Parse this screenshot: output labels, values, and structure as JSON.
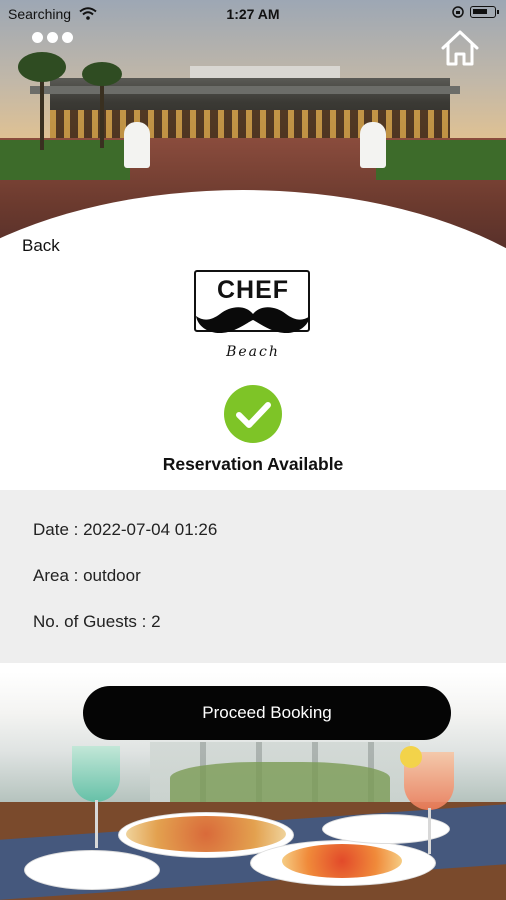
{
  "status_bar": {
    "carrier": "Searching",
    "time": "1:27 AM"
  },
  "navigation": {
    "back_label": "Back"
  },
  "restaurant": {
    "logo_text": "CHEF",
    "logo_subtext": "Beach"
  },
  "reservation": {
    "status": "Reservation Available",
    "status_color": "#7ec427",
    "date_label": "Date : 2022-07-04 01:26",
    "area_label": "Area : outdoor",
    "guests_label": "No. of Guests : 2"
  },
  "actions": {
    "proceed_label": "Proceed Booking"
  },
  "icons": {
    "menu": "more-dots-icon",
    "home": "home-icon",
    "wifi": "wifi-icon",
    "battery": "battery-icon",
    "status": "checkmark-icon"
  }
}
